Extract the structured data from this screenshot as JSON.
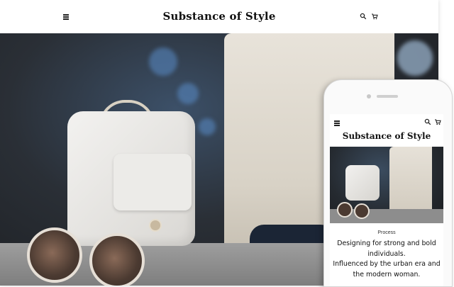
{
  "desktop": {
    "site_title": "Substance of Style",
    "icons": [
      "hamburger-icon",
      "search-icon",
      "cart-icon"
    ]
  },
  "phone": {
    "site_title": "Substance of Style",
    "section_label": "Process",
    "body_lines": [
      "Designing for strong and bold",
      "individuals.",
      "Influenced by the urban era and",
      "the modern woman."
    ],
    "icons": [
      "hamburger-icon",
      "search-icon",
      "cart-icon"
    ]
  },
  "colors": {
    "text": "#111111",
    "header_bg": "#ffffff"
  }
}
